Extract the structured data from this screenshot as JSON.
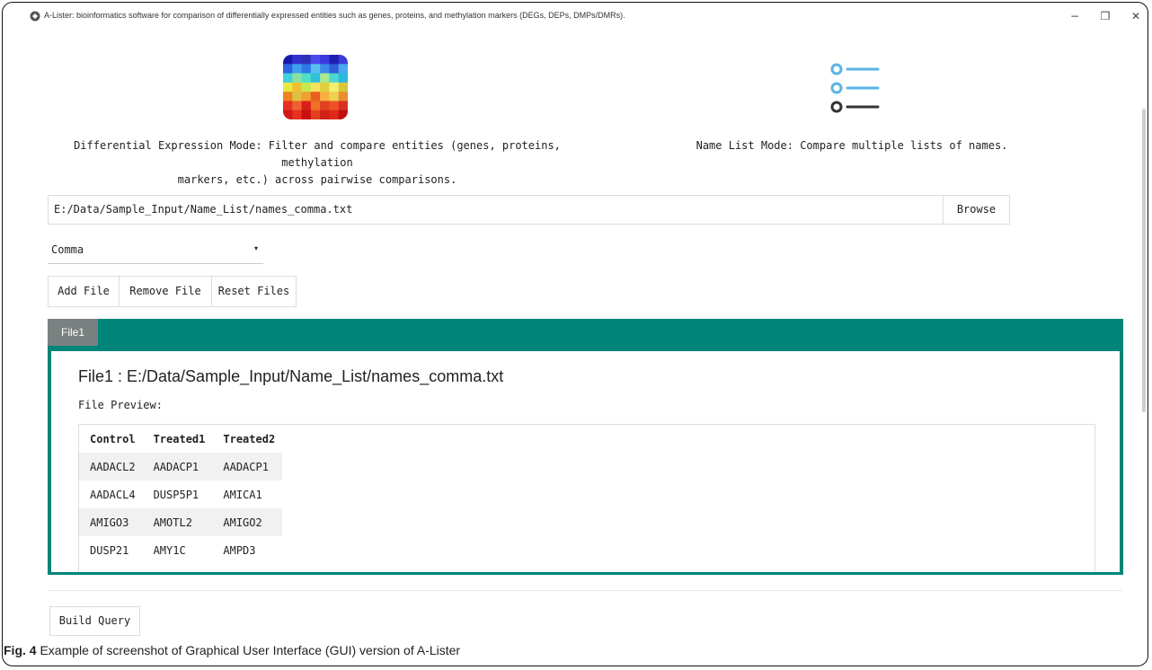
{
  "window": {
    "title": "A-Lister: bioinformatics software for comparison of differentially expressed entities such as genes, proteins, and methylation markers (DEGs, DEPs, DMPs/DMRs).",
    "minimize_glyph": "−",
    "maximize_glyph": "❐",
    "close_glyph": "✕"
  },
  "modes": {
    "differential": {
      "icon": "heatmap-icon",
      "line1": "Differential Expression Mode: Filter and compare entities (genes, proteins, methylation",
      "line2": "markers, etc.) across pairwise comparisons."
    },
    "namelist": {
      "icon": "list-icon",
      "text": "Name List Mode: Compare multiple lists of names."
    }
  },
  "file_input": {
    "path": "E:/Data/Sample_Input/Name_List/names_comma.txt",
    "browse_label": "Browse"
  },
  "delimiter": {
    "selected": "Comma",
    "caret": "▾"
  },
  "buttons": {
    "add_file": "Add File",
    "remove_file": "Remove File",
    "reset_files": "Reset Files",
    "build_query": "Build Query"
  },
  "tabs": [
    {
      "label": "File1",
      "active": true
    }
  ],
  "file_panel": {
    "heading": "File1 : E:/Data/Sample_Input/Name_List/names_comma.txt",
    "preview_label": "File Preview:",
    "columns": [
      "Control",
      "Treated1",
      "Treated2"
    ],
    "rows": [
      [
        "AADACL2",
        "AADACP1",
        "AADACP1"
      ],
      [
        "AADACL4",
        "DUSP5P1",
        "AMICA1"
      ],
      [
        "AMIGO3",
        "AMOTL2",
        "AMIGO2"
      ],
      [
        "DUSP21",
        "AMY1C",
        "AMPD3"
      ]
    ]
  },
  "caption": {
    "label": "Fig. 4",
    "text": " Example of screenshot of Graphical User Interface (GUI) version of A-Lister"
  },
  "colors": {
    "tab_panel": "#00857a",
    "tab_active": "#7a8180",
    "list_icon_blue": "#5ab4e6",
    "list_icon_dark": "#333333"
  }
}
